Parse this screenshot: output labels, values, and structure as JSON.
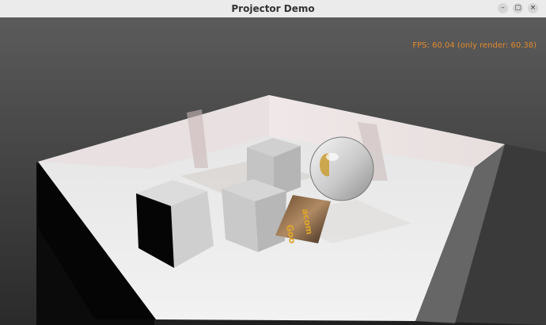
{
  "window": {
    "title": "Projector Demo",
    "buttons": {
      "minimize_icon": "minimize-icon",
      "maximize_icon": "maximize-icon",
      "close_icon": "close-icon"
    }
  },
  "hud": {
    "fps_text": "FPS: 60.04 (only render: 60.38)"
  },
  "scene": {
    "poster_text_top": "acom",
    "poster_text_bottom": "Goo",
    "colors": {
      "bg_top": "#5a5a5a",
      "bg_bottom": "#2a2a2a",
      "floor": "#e7e7e7",
      "wall": "#d9d4d4",
      "outer_wall": "#0a0a0a",
      "sphere": "#cfcfcf",
      "accent": "#e08a2b"
    }
  }
}
